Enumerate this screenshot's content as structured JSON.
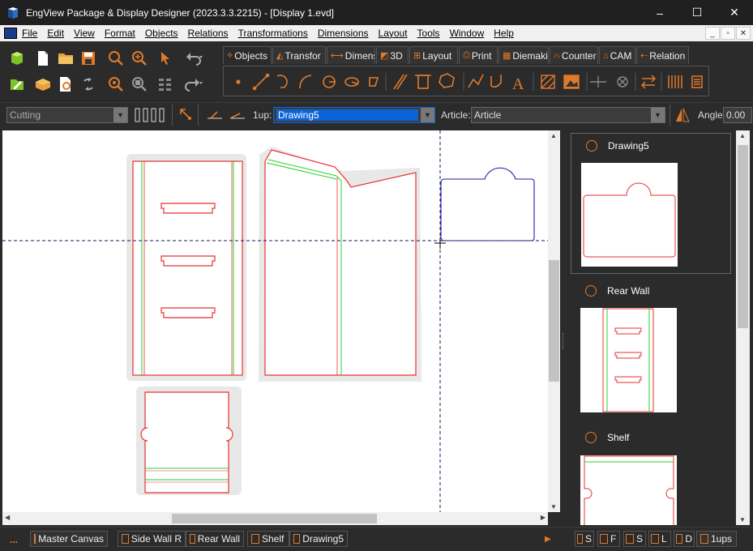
{
  "window": {
    "title": "EngView Package & Display Designer (2023.3.3.2215) - [Display 1.evd]",
    "controls": [
      "–",
      "☐",
      "✕"
    ]
  },
  "menu": [
    "File",
    "Edit",
    "View",
    "Format",
    "Objects",
    "Relations",
    "Transformations",
    "Dimensions",
    "Layout",
    "Tools",
    "Window",
    "Help"
  ],
  "mdi_controls": [
    "_",
    "▫",
    "✕"
  ],
  "tabs": [
    {
      "label": "Objects",
      "icon": "objects-icon"
    },
    {
      "label": "Transfor",
      "icon": "transform-icon"
    },
    {
      "label": "Dimensi",
      "icon": "dimensions-icon"
    },
    {
      "label": "3D",
      "icon": "3d-icon"
    },
    {
      "label": "Layout",
      "icon": "layout-icon"
    },
    {
      "label": "Print",
      "icon": "print-icon"
    },
    {
      "label": "Diemaki",
      "icon": "diemaking-icon"
    },
    {
      "label": "Counter",
      "icon": "counter-icon"
    },
    {
      "label": "CAM",
      "icon": "cam-icon"
    },
    {
      "label": "Relation",
      "icon": "relations-icon"
    }
  ],
  "propbar": {
    "cutting_value": "Cutting",
    "oneup_label": "1up:",
    "oneup_value": "Drawing5",
    "article_label": "Article:",
    "article_value": "Article",
    "angle_label": "Angle",
    "angle_value": "0.00"
  },
  "side_panel": {
    "items": [
      {
        "name": "Drawing5"
      },
      {
        "name": "Rear Wall"
      },
      {
        "name": "Shelf"
      }
    ]
  },
  "bottom_tabs": [
    "Master Canvas",
    "Side Wall R",
    "Rear Wall",
    "Shelf",
    "Drawing5"
  ],
  "bottom_more": "...",
  "side_bottom_tabs": [
    "S",
    "F",
    "S",
    "L",
    "D",
    "1ups"
  ],
  "colors": {
    "accent": "#e07a2a",
    "cut_line": "#e8312f",
    "crease_line": "#2cd12c",
    "selected_line": "#1a1aa8",
    "selection_highlight": "#0a64d8"
  }
}
